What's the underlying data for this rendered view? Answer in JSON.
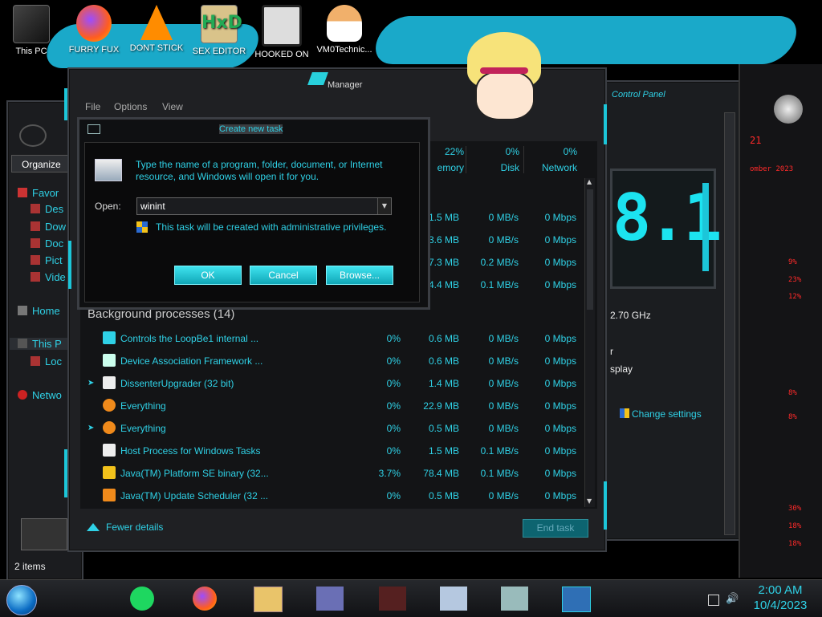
{
  "desktop": {
    "icons": [
      {
        "label": "This PC"
      },
      {
        "label": "FURRY FUX"
      },
      {
        "label": "DONT STICK"
      },
      {
        "label": "SEX EDITOR"
      },
      {
        "label": "HOOKED ON"
      },
      {
        "label": "VM0Technic..."
      }
    ]
  },
  "explorer": {
    "organize_label": "Organize",
    "sidebar": [
      {
        "label": "Favor"
      },
      {
        "label": "Des"
      },
      {
        "label": "Dow"
      },
      {
        "label": "Doc"
      },
      {
        "label": "Pict"
      },
      {
        "label": "Vide"
      },
      {
        "label": "Home"
      },
      {
        "label": "This P"
      },
      {
        "label": "Loc"
      },
      {
        "label": "Netwo"
      }
    ],
    "status_items": "2 items"
  },
  "control_panel": {
    "title": "Control Panel",
    "version_text": "8.1",
    "cpu_speed": "2.70 GHz",
    "partial_r": "r",
    "partial_display": "splay",
    "change_settings": "Change settings"
  },
  "task_manager": {
    "title": "Manager",
    "menu": {
      "file": "File",
      "options": "Options",
      "view": "View"
    },
    "columns": {
      "memory": {
        "pct": "22%",
        "label": "emory"
      },
      "disk": {
        "pct": "0%",
        "label": "Disk"
      },
      "network": {
        "pct": "0%",
        "label": "Network"
      }
    },
    "top_rows": [
      {
        "mem": "1.5 MB",
        "disk": "0 MB/s",
        "net": "0 Mbps"
      },
      {
        "mem": "3.6 MB",
        "disk": "0 MB/s",
        "net": "0 Mbps"
      },
      {
        "mem": "7.3 MB",
        "disk": "0.2 MB/s",
        "net": "0 Mbps"
      },
      {
        "mem": "4.4 MB",
        "disk": "0.1 MB/s",
        "net": "0 Mbps"
      }
    ],
    "section_header": "Background processes (14)",
    "processes": [
      {
        "name": "Controls the LoopBe1 internal ...",
        "cpu": "0%",
        "mem": "0.6 MB",
        "disk": "0 MB/s",
        "net": "0 Mbps",
        "expand": false
      },
      {
        "name": "Device Association Framework ...",
        "cpu": "0%",
        "mem": "0.6 MB",
        "disk": "0 MB/s",
        "net": "0 Mbps",
        "expand": false
      },
      {
        "name": "DissenterUpgrader (32 bit)",
        "cpu": "0%",
        "mem": "1.4 MB",
        "disk": "0 MB/s",
        "net": "0 Mbps",
        "expand": true
      },
      {
        "name": "Everything",
        "cpu": "0%",
        "mem": "22.9 MB",
        "disk": "0 MB/s",
        "net": "0 Mbps",
        "expand": false
      },
      {
        "name": "Everything",
        "cpu": "0%",
        "mem": "0.5 MB",
        "disk": "0 MB/s",
        "net": "0 Mbps",
        "expand": true
      },
      {
        "name": "Host Process for Windows Tasks",
        "cpu": "0%",
        "mem": "1.5 MB",
        "disk": "0.1 MB/s",
        "net": "0 Mbps",
        "expand": false
      },
      {
        "name": "Java(TM) Platform SE binary (32...",
        "cpu": "3.7%",
        "mem": "78.4 MB",
        "disk": "0.1 MB/s",
        "net": "0 Mbps",
        "expand": false
      },
      {
        "name": "Java(TM) Update Scheduler (32 ...",
        "cpu": "0%",
        "mem": "0.5 MB",
        "disk": "0 MB/s",
        "net": "0 Mbps",
        "expand": false
      }
    ],
    "fewer_details": "Fewer details",
    "end_task": "End task"
  },
  "run_dialog": {
    "title": "Create new task",
    "description": "Type the name of a program, folder, document, or Internet resource, and Windows will open it for you.",
    "open_label": "Open:",
    "open_value": "winint",
    "admin_note": "This task will be created with administrative privileges.",
    "ok": "OK",
    "cancel": "Cancel",
    "browse": "Browse..."
  },
  "red_panel": {
    "lines": [
      "21",
      "omber 2023",
      "9%",
      "23%",
      "12%",
      "8%",
      "8%",
      "30%",
      "18%",
      "18%"
    ]
  },
  "taskbar": {
    "time": "2:00 AM",
    "date": "10/4/2023"
  },
  "colors": {
    "accent": "#1cc6d9",
    "text_cyan": "#2fd1e6",
    "red": "#ff2a2a"
  }
}
